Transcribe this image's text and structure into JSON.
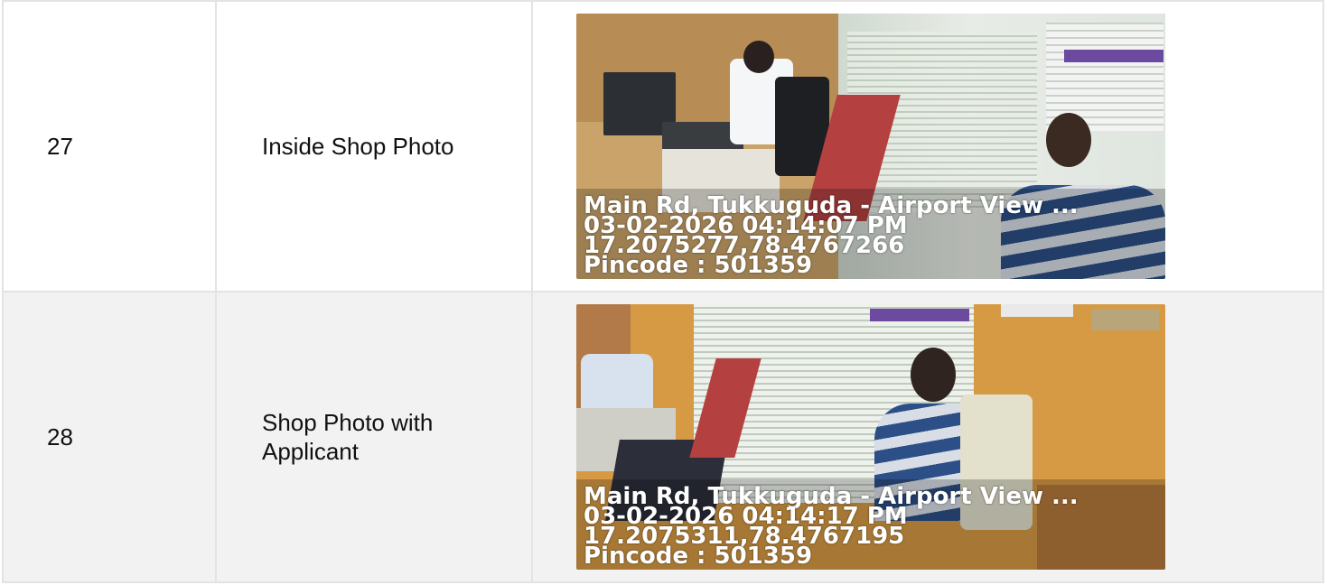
{
  "rows": [
    {
      "number": "27",
      "label": "Inside Shop Photo",
      "photo_alt": "inside-shop-photo",
      "stamp": {
        "address": "Main Rd, Tukkuguda - Airport View ...",
        "datetime": "03-02-2026 04:14:07 PM",
        "coords": "17.2075277,78.4767266",
        "pincode": "Pincode : 501359"
      }
    },
    {
      "number": "28",
      "label": "Shop Photo with Applicant",
      "photo_alt": "shop-photo-with-applicant",
      "stamp": {
        "address": "Main Rd, Tukkuguda - Airport View ...",
        "datetime": "03-02-2026 04:14:17 PM",
        "coords": "17.2075311,78.4767195",
        "pincode": "Pincode : 501359"
      }
    }
  ]
}
